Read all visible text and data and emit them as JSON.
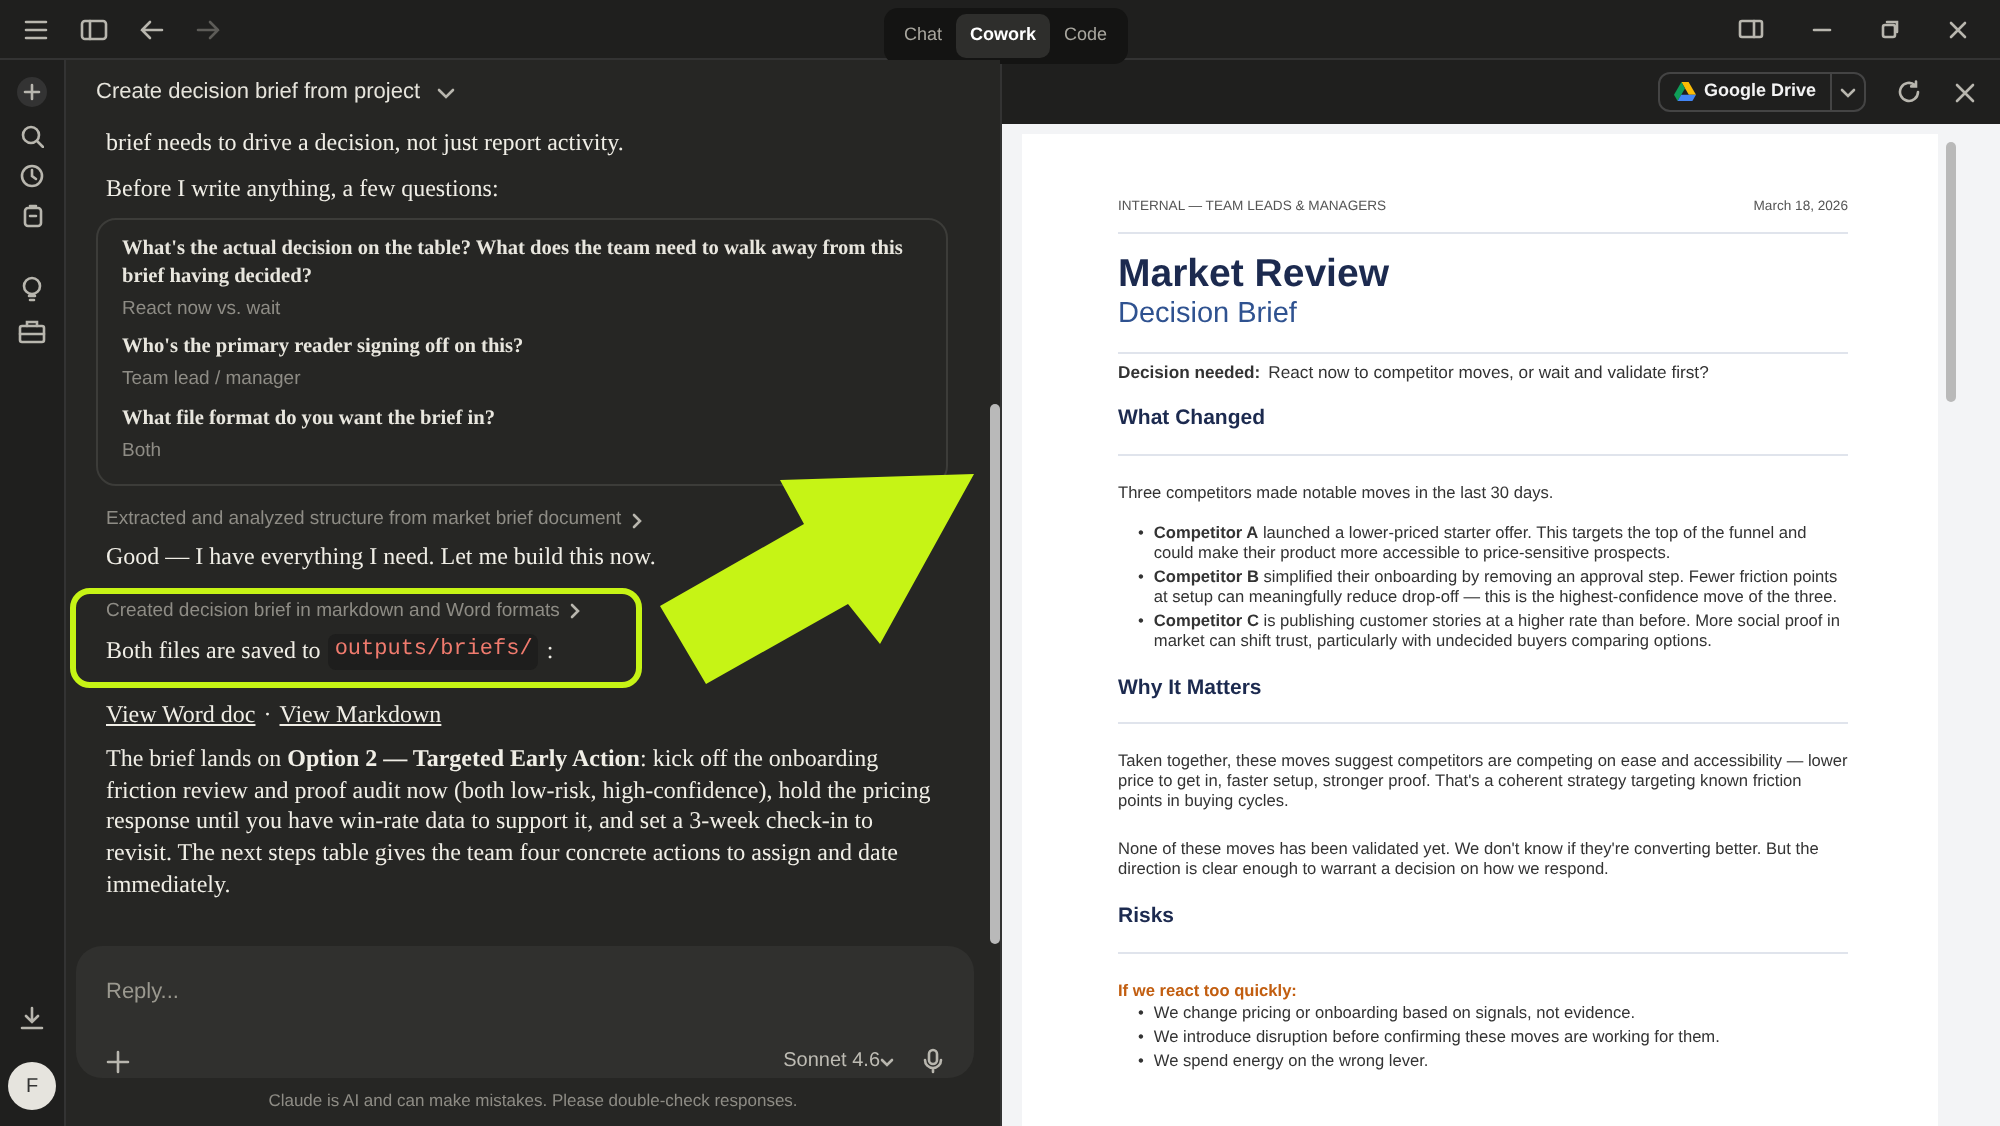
{
  "top_bar": {
    "mode_tabs": [
      {
        "label": "Chat",
        "selected": false
      },
      {
        "label": "Cowork",
        "selected": true
      },
      {
        "label": "Code",
        "selected": false
      }
    ],
    "forward_disabled": true
  },
  "rail": {
    "avatar": "F"
  },
  "conversation": {
    "title": "Create decision brief from project",
    "blocks": [
      {
        "kind": "text",
        "text": "brief needs to drive a decision, not just report activity."
      },
      {
        "kind": "text",
        "text": "Before I write anything, a few questions:"
      },
      {
        "kind": "questions",
        "items": [
          {
            "question": "What's the actual decision on the table? What does the team need to walk away from this brief having decided?",
            "answer": "React now vs. wait"
          },
          {
            "question": "Who's the primary reader signing off on this?",
            "answer": "Team lead / manager"
          },
          {
            "question": "What file format do you want the brief in?",
            "answer": "Both"
          }
        ]
      },
      {
        "kind": "step",
        "text": "Extracted and analyzed structure from market brief document"
      },
      {
        "kind": "text",
        "text": "Good — I have everything I need. Let me build this now."
      },
      {
        "kind": "highlight",
        "blocks": [
          {
            "kind": "step",
            "text": "Created decision brief in markdown and Word formats"
          },
          {
            "kind": "code_text",
            "text": "Both files are saved to",
            "code": "outputs/briefs/",
            "after": ":"
          }
        ]
      },
      {
        "kind": "links",
        "links": [
          "View Word doc",
          "View Markdown"
        ],
        "separator": "·"
      },
      {
        "kind": "text",
        "text": "The brief lands on **Option 2 — Targeted Early Action**: kick off the onboarding friction review and proof audit now (both low-risk, high-confidence), hold the pricing response until you have win-rate data to support it, and set a 3-week check-in to revisit. The next steps table gives the team four concrete actions to assign and date immediately."
      }
    ]
  },
  "composer": {
    "placeholder": "Reply...",
    "model": "Sonnet 4.6",
    "disclaimer": "Claude is AI and can make mistakes. Please double-check responses."
  },
  "annotation": {
    "kind": "arrow"
  },
  "preview": {
    "destination": "Google Drive",
    "document": {
      "audience": "INTERNAL — TEAM LEADS & MANAGERS",
      "date": "March 18, 2026",
      "title": "Market Review",
      "subtitle": "Decision Brief",
      "decision_label": "Decision needed:",
      "decision": "React now to competitor moves, or wait and validate first?",
      "sections": [
        {
          "heading": "What Changed",
          "blocks": [
            {
              "kind": "paragraph",
              "text": "Three competitors made notable moves in the last 30 days."
            },
            {
              "kind": "bullets",
              "marker": "•",
              "items": [
                "**Competitor A** launched a lower-priced starter offer. This targets the top of the funnel and could make their product more accessible to price-sensitive prospects.",
                "**Competitor B** simplified their onboarding by removing an approval step. Fewer friction points at setup can meaningfully reduce drop-off — this is the highest-confidence move of the three.",
                "**Competitor C** is publishing customer stories at a higher rate than before. More social proof in market can shift trust, particularly with undecided buyers comparing options."
              ]
            }
          ]
        },
        {
          "heading": "Why It Matters",
          "blocks": [
            {
              "kind": "paragraph",
              "text": "Taken together, these moves suggest competitors are competing on ease and accessibility — lower price to get in, faster setup, stronger proof. That's a coherent strategy targeting known friction points in buying cycles."
            },
            {
              "kind": "paragraph",
              "text": "None of these moves has been validated yet. We don't know if they're converting better. But the direction is clear enough to warrant a decision on how we respond."
            }
          ]
        },
        {
          "heading": "Risks",
          "blocks": [
            {
              "kind": "subheading",
              "text": "If we react too quickly:"
            },
            {
              "kind": "bullets",
              "marker": "•",
              "items": [
                "We change pricing or onboarding based on signals, not evidence.",
                "We introduce disruption before confirming these moves are working for them.",
                "We spend energy on the wrong lever."
              ]
            }
          ]
        }
      ]
    }
  }
}
